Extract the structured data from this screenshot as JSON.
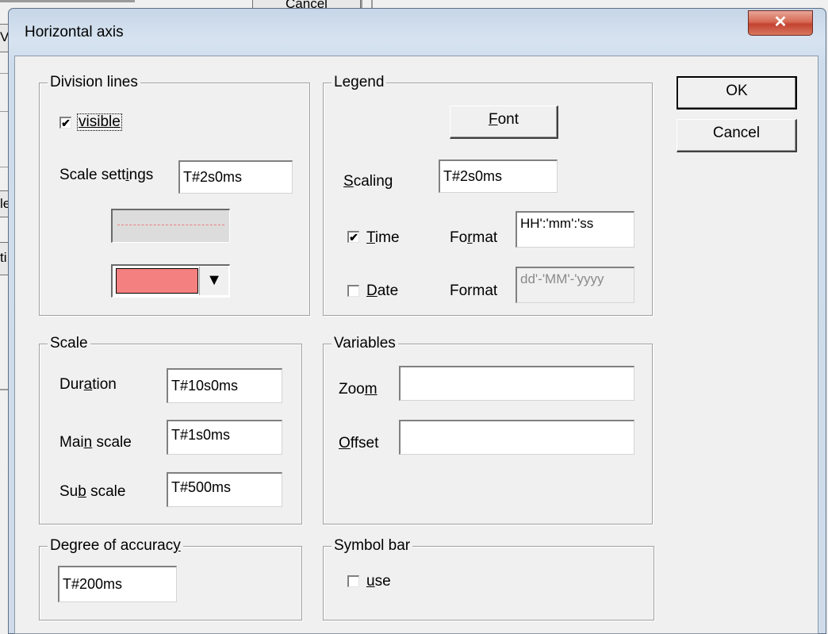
{
  "background": {
    "cancel_label": "Cancel",
    "frag_1": "V",
    "frag_2": "le",
    "frag_3": "ti"
  },
  "dialog": {
    "title": "Horizontal axis",
    "close_glyph": "✕",
    "ok_label": "OK",
    "cancel_label": "Cancel"
  },
  "division_lines": {
    "title": "Division lines",
    "visible_label": "visible",
    "visible_checked": true,
    "scale_settings_pre": "Scale sett",
    "scale_settings_u": "i",
    "scale_settings_post": "ngs",
    "scale_settings_value": "T#2s0ms",
    "line_color": "#f58080",
    "combo_arrow": "▼"
  },
  "legend": {
    "title": "Legend",
    "font_u": "F",
    "font_rest": "ont",
    "scaling_u": "S",
    "scaling_rest": "caling",
    "scaling_value": "T#2s0ms",
    "time_u": "T",
    "time_rest": "ime",
    "time_checked": true,
    "time_format_pre": "Fo",
    "time_format_u": "r",
    "time_format_post": "mat",
    "time_format_value": "HH':'mm':'ss",
    "date_u": "D",
    "date_rest": "ate",
    "date_checked": false,
    "date_format_label": "Format",
    "date_format_value": "dd'-'MM'-'yyyy"
  },
  "scale": {
    "title": "Scale",
    "duration_pre": "Dur",
    "duration_u": "a",
    "duration_post": "tion",
    "duration_value": "T#10s0ms",
    "main_pre": "Mai",
    "main_u": "n",
    "main_post": " scale",
    "main_value": "T#1s0ms",
    "sub_pre": "Su",
    "sub_u": "b",
    "sub_post": " scale",
    "sub_value": "T#500ms"
  },
  "variables": {
    "title": "Variables",
    "zoom_pre": "Zoo",
    "zoom_u": "m",
    "zoom_value": "",
    "offset_u": "O",
    "offset_rest": "ffset",
    "offset_value": ""
  },
  "accuracy": {
    "title_pre": "Degree of accurac",
    "title_u": "y",
    "value": "T#200ms"
  },
  "symbol_bar": {
    "title": "Symbol bar",
    "use_u": "u",
    "use_rest": "se",
    "use_checked": false
  },
  "check_glyph": "✔"
}
